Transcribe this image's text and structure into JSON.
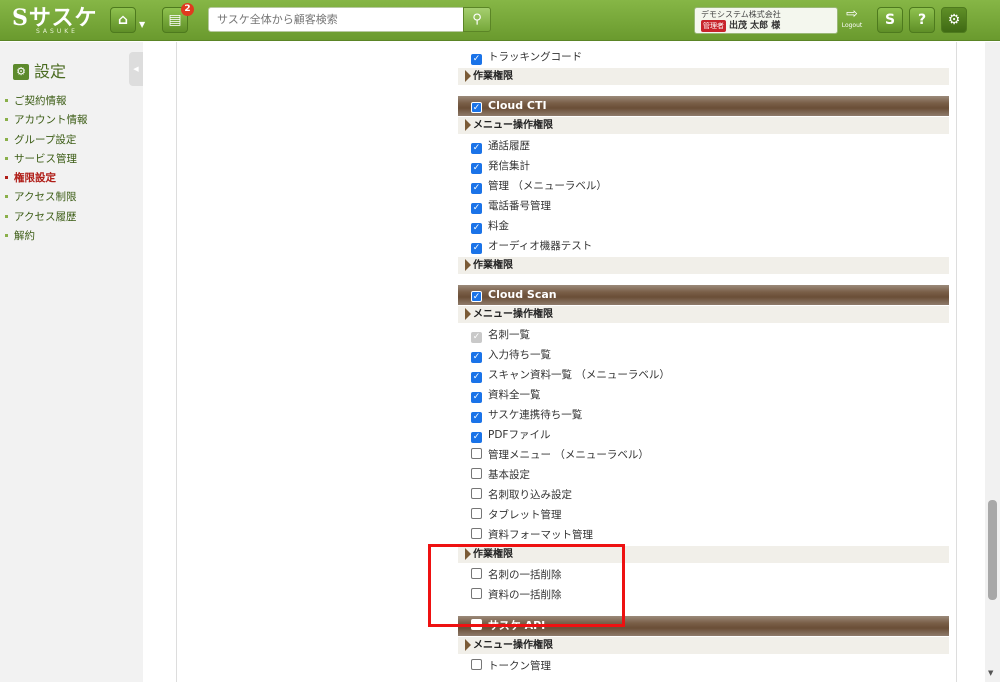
{
  "header": {
    "logo": "Sサスケ",
    "logo_sub": "SASUKE",
    "notification_count": "2",
    "search_placeholder": "サスケ全体から顧客検索",
    "company": "デモシステム株式会社",
    "role": "管理者",
    "user_name": "出茂 太郎 様",
    "logout_label": "Logout",
    "help_label": "?"
  },
  "sidebar": {
    "title": "設定",
    "items": [
      {
        "label": "ご契約情報"
      },
      {
        "label": "アカウント情報"
      },
      {
        "label": "グループ設定"
      },
      {
        "label": "サービス管理"
      },
      {
        "label": "権限設定"
      },
      {
        "label": "アクセス制限"
      },
      {
        "label": "アクセス履歴"
      },
      {
        "label": "解約"
      }
    ],
    "active_item": "権限設定"
  },
  "permissions": {
    "top": {
      "items": [
        {
          "label": "トラッキングコード",
          "state": "checked"
        }
      ],
      "work_header": "作業権限"
    },
    "cloud_cti": {
      "title": "Cloud CTI",
      "state": "checked",
      "menu_header": "メニュー操作権限",
      "items": [
        {
          "label": "通話履歴",
          "state": "checked"
        },
        {
          "label": "発信集計",
          "state": "checked"
        },
        {
          "label": "管理 （メニューラベル）",
          "state": "checked"
        },
        {
          "label": "電話番号管理",
          "state": "checked"
        },
        {
          "label": "料金",
          "state": "checked"
        },
        {
          "label": "オーディオ機器テスト",
          "state": "checked"
        }
      ],
      "work_header": "作業権限"
    },
    "cloud_scan": {
      "title": "Cloud Scan",
      "state": "checked",
      "menu_header": "メニュー操作権限",
      "items": [
        {
          "label": "名刺一覧",
          "state": "disabled"
        },
        {
          "label": "入力待ち一覧",
          "state": "checked"
        },
        {
          "label": "スキャン資料一覧 （メニューラベル）",
          "state": "checked"
        },
        {
          "label": "資料全一覧",
          "state": "checked"
        },
        {
          "label": "サスケ連携待ち一覧",
          "state": "checked"
        },
        {
          "label": "PDFファイル",
          "state": "checked"
        },
        {
          "label": "管理メニュー （メニューラベル）",
          "state": "unchecked"
        },
        {
          "label": "基本設定",
          "state": "unchecked"
        },
        {
          "label": "名刺取り込み設定",
          "state": "unchecked"
        },
        {
          "label": "タブレット管理",
          "state": "unchecked"
        },
        {
          "label": "資料フォーマット管理",
          "state": "unchecked"
        }
      ],
      "work_header": "作業権限",
      "work_items": [
        {
          "label": "名刺の一括削除",
          "state": "unchecked"
        },
        {
          "label": "資料の一括削除",
          "state": "unchecked"
        }
      ]
    },
    "sasuke_api": {
      "title": "サスケ API",
      "state": "unchecked",
      "menu_header": "メニュー操作権限",
      "items": [
        {
          "label": "トークン管理",
          "state": "unchecked"
        }
      ]
    }
  },
  "colors": {
    "header_green": "#7aa83a",
    "section_brown": "#6a4e37",
    "checkbox_blue": "#1a73e8",
    "highlight_red": "#ee1111",
    "active_menu": "#b01e18"
  }
}
